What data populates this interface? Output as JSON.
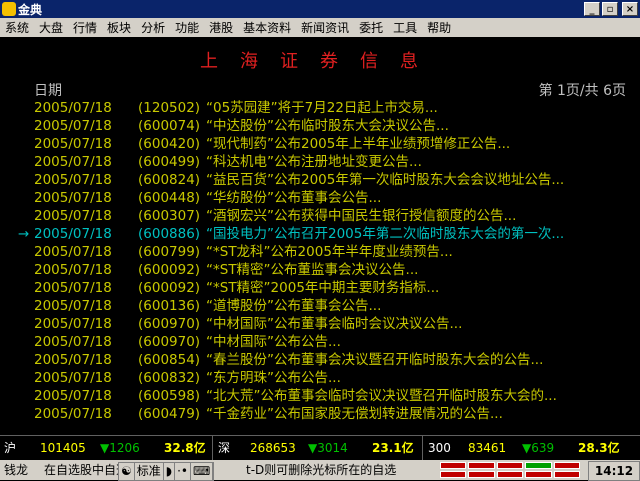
{
  "window": {
    "title": "金典"
  },
  "menu": [
    "系统",
    "大盘",
    "行情",
    "板块",
    "分析",
    "功能",
    "港股",
    "基本资料",
    "新闻资讯",
    "委托",
    "工具",
    "帮助"
  ],
  "page": {
    "title": "上海证券信息",
    "date_header": "日期",
    "page_indicator": "第 1页/共 6页"
  },
  "rows": [
    {
      "date": "2005/07/18",
      "code": "(120502)",
      "text": "“05苏园建”将于7月22日起上市交易..."
    },
    {
      "date": "2005/07/18",
      "code": "(600074)",
      "text": "“中达股份”公布临时股东大会决议公告..."
    },
    {
      "date": "2005/07/18",
      "code": "(600420)",
      "text": "“现代制药”公布2005年上半年业绩预增修正公告..."
    },
    {
      "date": "2005/07/18",
      "code": "(600499)",
      "text": "“科达机电”公布注册地址变更公告..."
    },
    {
      "date": "2005/07/18",
      "code": "(600824)",
      "text": "“益民百货”公布2005年第一次临时股东大会会议地址公告..."
    },
    {
      "date": "2005/07/18",
      "code": "(600448)",
      "text": "“华纺股份”公布董事会公告..."
    },
    {
      "date": "2005/07/18",
      "code": "(600307)",
      "text": "“酒钢宏兴”公布获得中国民生银行授信额度的公告..."
    },
    {
      "date": "2005/07/18",
      "code": "(600886)",
      "text": "“国投电力”公布召开2005年第二次临时股东大会的第一次...",
      "selected": true
    },
    {
      "date": "2005/07/18",
      "code": "(600799)",
      "text": "“*ST龙科”公布2005年半年度业绩预告..."
    },
    {
      "date": "2005/07/18",
      "code": "(600092)",
      "text": "“*ST精密”公布董监事会决议公告..."
    },
    {
      "date": "2005/07/18",
      "code": "(600092)",
      "text": "“*ST精密”2005年中期主要财务指标..."
    },
    {
      "date": "2005/07/18",
      "code": "(600136)",
      "text": "“道博股份”公布董事会公告..."
    },
    {
      "date": "2005/07/18",
      "code": "(600970)",
      "text": "“中材国际”公布董事会临时会议决议公告..."
    },
    {
      "date": "2005/07/18",
      "code": "(600970)",
      "text": "“中材国际”公布公告..."
    },
    {
      "date": "2005/07/18",
      "code": "(600854)",
      "text": "“春兰股份”公布董事会决议暨召开临时股东大会的公告..."
    },
    {
      "date": "2005/07/18",
      "code": "(600832)",
      "text": "“东方明珠”公布公告..."
    },
    {
      "date": "2005/07/18",
      "code": "(600598)",
      "text": "“北大荒”公布董事会临时会议决议暨召开临时股东大会的..."
    },
    {
      "date": "2005/07/18",
      "code": "(600479)",
      "text": "“千金药业”公布国家股无偿划转进展情况的公告..."
    }
  ],
  "status": {
    "sh_label": "沪",
    "sh_index": "101405",
    "sh_change": "▼1206",
    "sh_amount": "32.8亿",
    "sz_label": "深",
    "sz_index": "268653",
    "sz_change": "▼3014",
    "sz_amount": "23.1亿",
    "idx300_label": "300",
    "idx300_index": "83461",
    "idx300_change": "▼639",
    "idx300_amount": "28.3亿"
  },
  "bottom": {
    "left_label": "钱龙",
    "hint": "在自选股中自选股中删除光标所在的自选",
    "ime_mode": "标准",
    "hint2": "t-D则可删除光标所在的自选",
    "time": "14:12"
  },
  "colors": {
    "title": "#e02020",
    "row": "#c8c800",
    "selected": "#00c0c0",
    "up": "#ff3030",
    "down": "#00c000"
  }
}
